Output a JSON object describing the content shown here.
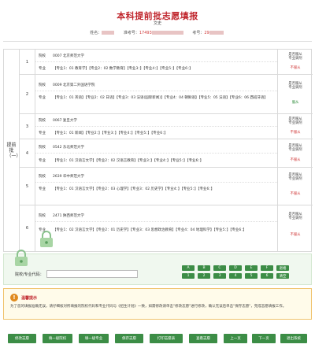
{
  "header": {
    "title": "本科提前批志愿填报",
    "subtitle": "文史",
    "name_label": "姓名：",
    "exam_label": "准考号：",
    "exam_number_prefix": "17493",
    "id_label": "考号：",
    "id_prefix": "29"
  },
  "table": {
    "left_label": "提前批（一）",
    "volunteers": [
      {
        "num": "1",
        "school_label": "院校",
        "school": "0007 北京师范大学",
        "major_label": "专业",
        "majors": "【专业1：01 教育学】【专业2：02 数学教育】【专业3：】【专业4：】【专业5：】【专业6：】",
        "status_top": [
          "是否服从",
          "专业调剂"
        ],
        "status_bottom": "不服从"
      },
      {
        "num": "2",
        "school_label": "院校",
        "school": "0009 北京第二外国语学院",
        "major_label": "专业",
        "majors": "【专业1：01 英语】【专业2：02 日语】【专业3：03 法语(国际新闻)】【专业4：04 朝鲜语】【专业5：05 法语】【专业6：06 西班牙语】",
        "status_top": [
          "是否服从",
          "专业调剂"
        ],
        "status_bottom": "服从"
      },
      {
        "num": "3",
        "school_label": "院校",
        "school": "0067 复旦大学",
        "major_label": "专业",
        "majors": "【专业1：01 新闻】【专业2：】【专业3：】【专业4：】【专业5：】【专业6：】",
        "status_top": [
          "是否服从",
          "专业调剂"
        ],
        "status_bottom": "不服从"
      },
      {
        "num": "4",
        "school_label": "院校",
        "school": "0542 东北师范大学",
        "major_label": "专业",
        "majors": "【专业1：01 汉语言文学】【专业2：02 汉语言教育】【专业3：】【专业4：】【专业5：】【专业6：】",
        "status_top": [
          "是否服从",
          "专业调剂"
        ],
        "status_bottom": "不服从"
      },
      {
        "num": "5",
        "school_label": "院校",
        "school": "2639 华中师范大学",
        "major_label": "专业",
        "majors": "【专业1：01 汉语言文学】【专业2：03 心理学】【专业3：02 历史学】【专业4：】【专业5：】【专业6：】",
        "status_top": [
          "是否服从",
          "专业调剂"
        ],
        "status_bottom": "不服从"
      },
      {
        "num": "6",
        "school_label": "院校",
        "school": "2471 陕西师范大学",
        "major_label": "专业",
        "majors": "【专业1：02 汉语言文学】【专业2：01 历史学】【专业3：03 思想政治教育】【专业4：04 地理科学】【专业5：】【专业6：】",
        "status_top": [
          "是否服从",
          "专业调剂"
        ],
        "status_bottom": "不服从"
      }
    ]
  },
  "input": {
    "label": "院校/专业代码：",
    "value": "",
    "keys_row1": [
      "A",
      "B",
      "C",
      "D",
      "E",
      "F",
      "退格"
    ],
    "keys_row2": [
      "1",
      "2",
      "3",
      "4",
      "5",
      "6",
      "清空"
    ]
  },
  "warning": {
    "title": "温馨提示",
    "text": "为了您的填报准确无误，请仔细核对所填报的院校代码和专业代码与《招生计划》一致，如需修改请单击\"修改志愿\"进行修改，确认无误后单击\"保存志愿\"，完成志愿填报工作。"
  },
  "buttons": [
    "修改志愿",
    "填一级院校",
    "填一级专业",
    "保存志愿",
    "打印志愿表",
    "查看志愿",
    "上一页",
    "下一页",
    "退出系统"
  ],
  "colors": {
    "accent_green": "#3c8d46",
    "title_red": "#c0262d",
    "status_red": "#d03b3b"
  }
}
